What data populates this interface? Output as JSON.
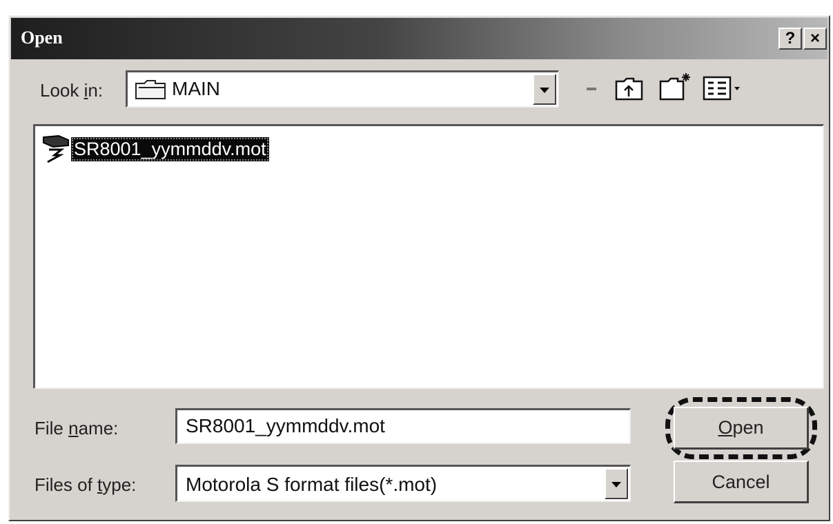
{
  "dialog": {
    "title": "Open",
    "help_button": "?",
    "close_button": "×"
  },
  "look_in": {
    "label_before": "Look ",
    "label_hotkey": "i",
    "label_after": "n:",
    "value": "MAIN"
  },
  "toolbar": {
    "back_icon": "back-arrow-icon",
    "up_icon": "up-one-level-folder-icon",
    "new_folder_icon": "new-folder-icon",
    "view_menu_icon": "view-menu-icon"
  },
  "file_list": {
    "items": [
      {
        "name": "SR8001_yymmddv.mot",
        "selected": true,
        "icon": "mot-file-icon"
      }
    ]
  },
  "file_name": {
    "label_before": "File ",
    "label_hotkey": "n",
    "label_after": "ame:",
    "value": "SR8001_yymmddv.mot"
  },
  "file_type": {
    "label_before": "Files of ",
    "label_hotkey": "t",
    "label_after": "ype:",
    "value": "Motorola S format files(*.mot)"
  },
  "buttons": {
    "open_hotkey": "O",
    "open_rest": "pen",
    "cancel": "Cancel"
  },
  "colors": {
    "face": "#d6d3ce",
    "selection": "#0a0a0a",
    "title_dark": "#1e1e1e"
  }
}
